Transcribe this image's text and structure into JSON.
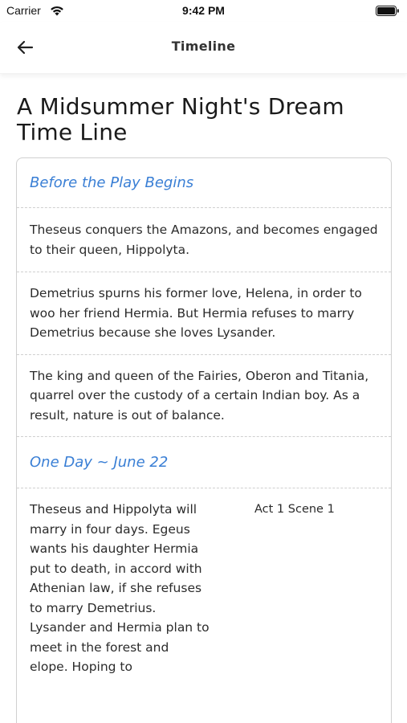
{
  "status_bar": {
    "carrier": "Carrier",
    "time": "9:42 PM",
    "icons": [
      "wifi-icon",
      "battery-icon"
    ]
  },
  "nav": {
    "title": "Timeline",
    "back_icon": "arrow-left-icon"
  },
  "page": {
    "title": "A Midsummer Night's Dream Time Line"
  },
  "colors": {
    "section_header": "#3a7fd5",
    "text": "#2b2b2b",
    "border": "#d0d0d0"
  },
  "sections": [
    {
      "header": "Before the Play Begins",
      "events": [
        "Theseus conquers the Amazons, and becomes engaged to their queen, Hippolyta.",
        "Demetrius spurns his former love, Helena, in order to woo her friend Hermia. But Hermia refuses to marry Demetrius because she loves Lysander.",
        "The king and queen of the Fairies, Oberon and Titania, quarrel over the custody of a certain Indian boy. As a result, nature is out of balance."
      ]
    },
    {
      "header": "One Day ~ June 22",
      "scene_events": [
        {
          "text": "Theseus and Hippolyta will marry in four days. Egeus wants his daughter Hermia put to death, in accord with Athenian law, if she refuses to marry Demetrius. Lysander and Hermia plan to meet in the forest and elope. Hoping to",
          "reference": "Act 1 Scene 1"
        }
      ]
    }
  ]
}
